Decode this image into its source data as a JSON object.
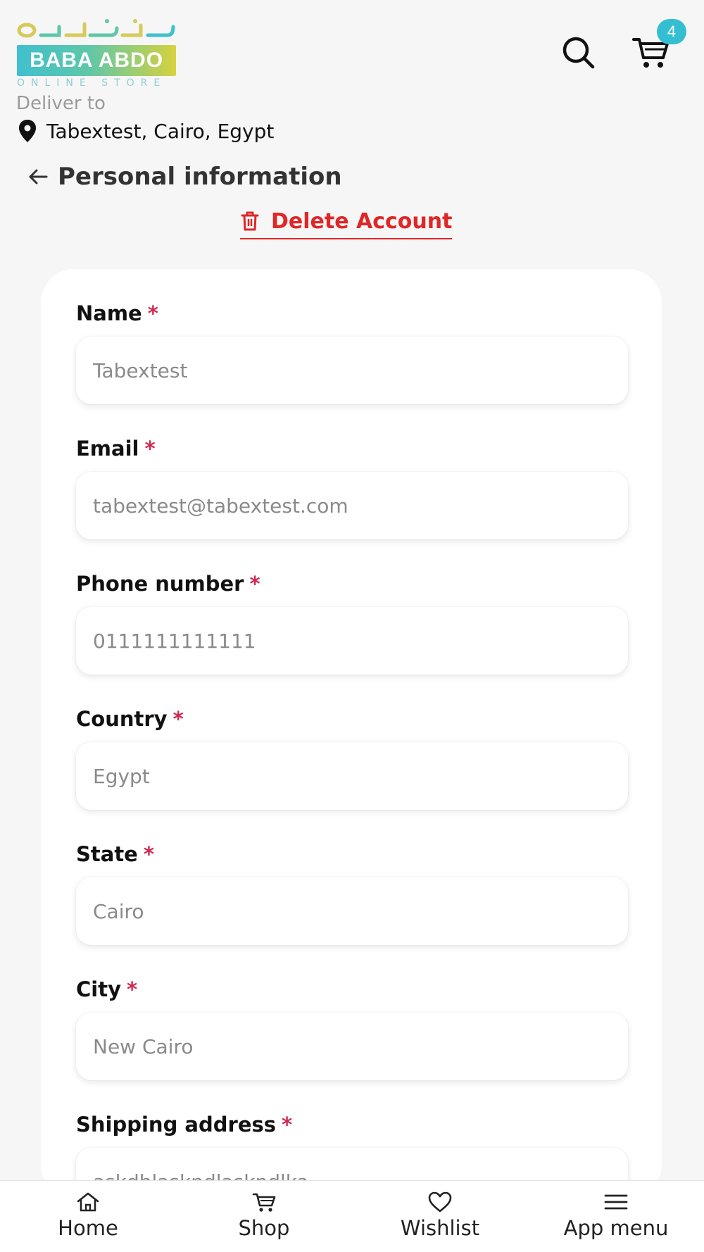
{
  "header": {
    "logo_text": "BABA ABDO",
    "logo_subtext": "ONLINE STORE",
    "cart_count": "4",
    "deliver_label": "Deliver to",
    "location": "Tabextest, Cairo, Egypt"
  },
  "page": {
    "title": "Personal information",
    "delete_label": "Delete Account"
  },
  "form": {
    "fields": [
      {
        "label": "Name",
        "required_mark": "*",
        "value": "Tabextest"
      },
      {
        "label": "Email",
        "required_mark": "*",
        "value": "tabextest@tabextest.com"
      },
      {
        "label": "Phone number",
        "required_mark": "*",
        "value": "0111111111111"
      },
      {
        "label": "Country",
        "required_mark": "*",
        "value": "Egypt"
      },
      {
        "label": "State",
        "required_mark": "*",
        "value": "Cairo"
      },
      {
        "label": "City",
        "required_mark": "*",
        "value": "New Cairo"
      },
      {
        "label": "Shipping address",
        "required_mark": "*",
        "value": "askdhlaskndlaskndlka"
      }
    ]
  },
  "nav": {
    "items": [
      {
        "label": "Home",
        "icon": "home-icon"
      },
      {
        "label": "Shop",
        "icon": "cart-icon"
      },
      {
        "label": "Wishlist",
        "icon": "heart-icon"
      },
      {
        "label": "App menu",
        "icon": "menu-icon"
      }
    ]
  },
  "colors": {
    "accent_red": "#e02626",
    "badge": "#33bfd1",
    "required": "#d2284f"
  }
}
